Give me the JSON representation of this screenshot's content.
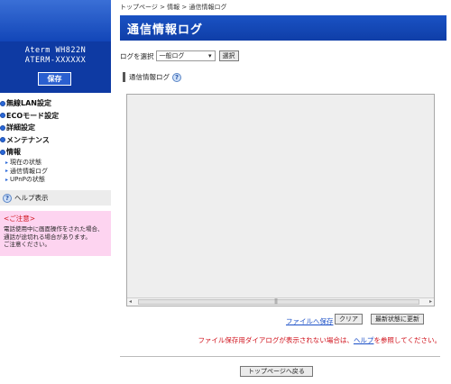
{
  "sidebar": {
    "device_model": "Aterm WH822N",
    "device_name": "ATERM-XXXXXX",
    "save_label": "保存",
    "nav": [
      {
        "label": "無線LAN設定"
      },
      {
        "label": "ECOモード設定"
      },
      {
        "label": "詳細設定"
      },
      {
        "label": "メンテナンス"
      },
      {
        "label": "情報"
      }
    ],
    "sub_items": [
      {
        "label": "現在の状態"
      },
      {
        "label": "通信情報ログ"
      },
      {
        "label": "UPnPの状態"
      }
    ],
    "help_label": "ヘルプ表示",
    "caution_title": "<ご注意>",
    "caution_text_1": "電話使用中に画面操作をされた場合、",
    "caution_text_2": "通話が途切れる場合があります。",
    "caution_text_3": "ご注意ください。"
  },
  "breadcrumb": "トップページ > 情報 > 通信情報ログ",
  "title": "通信情報ログ",
  "log_select": {
    "label": "ログを選択",
    "value": "一般ログ",
    "button": "選択"
  },
  "section_title": "通信情報ログ",
  "actions": {
    "file_save": "ファイルへ保存",
    "clear": "クリア",
    "refresh": "最新状態に更新"
  },
  "note": {
    "before": "ファイル保存用ダイアログが表示されない場合は、",
    "link": "ヘルプ",
    "after": "を参照してください。"
  },
  "back_to_top": "トップページへ戻る",
  "colors": {
    "accent_blue": "#0f3ea8",
    "sidebar_blue": "#1246b8",
    "caution_bg": "#fdd4f0",
    "warning_red": "#d0111b"
  }
}
